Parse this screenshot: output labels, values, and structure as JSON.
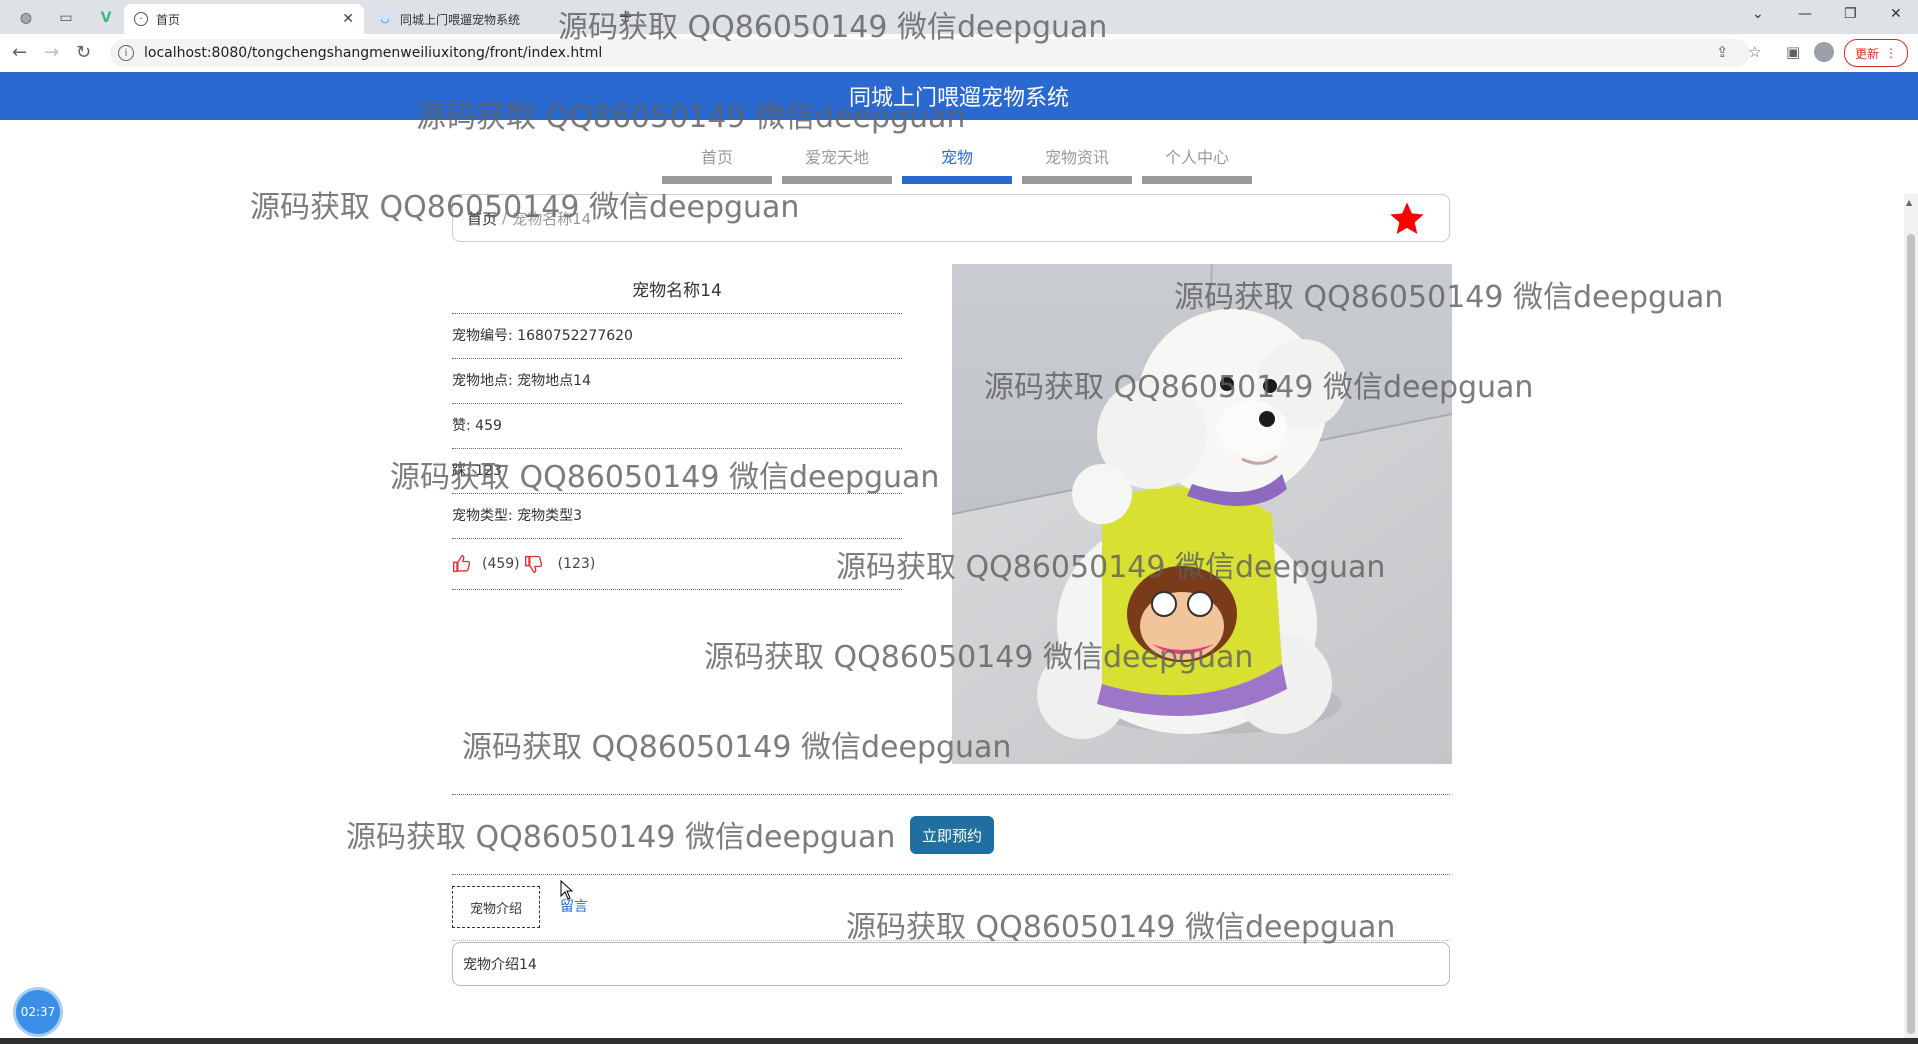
{
  "browser": {
    "tabs": [
      {
        "title": "首页",
        "active": true
      },
      {
        "title": "同城上门喂遛宠物系统",
        "active": false
      }
    ],
    "new_tab_symbol": "+",
    "url": "localhost:8080/tongchengshangmenweiliuxitong/front/index.html",
    "update_label": "更新",
    "icons": [
      "back-icon",
      "forward-icon",
      "reload-icon",
      "share-icon",
      "star-icon",
      "sidebar-icon",
      "profile-icon",
      "menu-icon"
    ]
  },
  "header": {
    "title": "同城上门喂遛宠物系统",
    "color": "#2a6ad0"
  },
  "nav": [
    {
      "label": "首页",
      "active": false
    },
    {
      "label": "爱宠天地",
      "active": false
    },
    {
      "label": "宠物",
      "active": true
    },
    {
      "label": "宠物资讯",
      "active": false
    },
    {
      "label": "个人中心",
      "active": false
    }
  ],
  "breadcrumb": {
    "home": "首页",
    "separator": "/",
    "current": "宠物名称14"
  },
  "pet": {
    "name": "宠物名称14",
    "rows": [
      "宠物编号: 1680752277620",
      "宠物地点: 宠物地点14",
      "赞: 459",
      "踩: 123",
      "宠物类型: 宠物类型3"
    ],
    "likes": "(459)",
    "dislikes": "(123)"
  },
  "actions": {
    "book_label": "立即预约"
  },
  "detail_tabs": {
    "intro_label": "宠物介绍",
    "comment_label": "留言"
  },
  "intro_text": "宠物介绍14",
  "clock": "02:37",
  "watermark_text": "源码获取 QQ86050149 微信deepguan"
}
